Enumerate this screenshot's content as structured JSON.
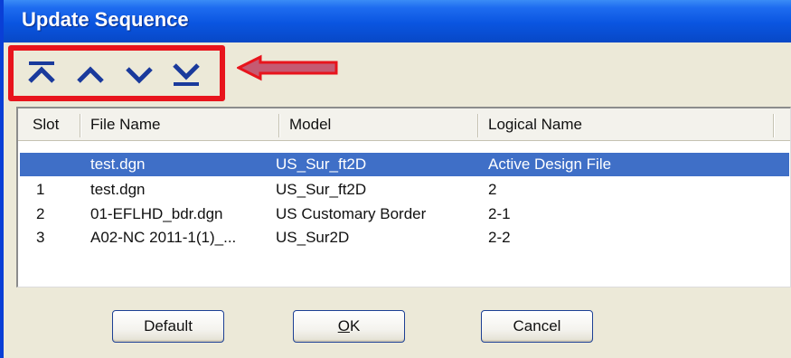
{
  "window": {
    "title": "Update Sequence"
  },
  "toolbar": {
    "buttons": [
      {
        "name": "move-to-top",
        "icon": "double-chevron-up-icon"
      },
      {
        "name": "move-up",
        "icon": "chevron-up-icon"
      },
      {
        "name": "move-down",
        "icon": "chevron-down-icon"
      },
      {
        "name": "move-to-bottom",
        "icon": "double-chevron-down-icon"
      }
    ]
  },
  "list": {
    "columns": [
      "Slot",
      "File Name",
      "Model",
      "Logical Name"
    ],
    "rows": [
      {
        "slot": "",
        "file": "test.dgn",
        "model": "US_Sur_ft2D",
        "logical": "Active Design File",
        "selected": true
      },
      {
        "slot": "1",
        "file": "test.dgn",
        "model": "US_Sur_ft2D",
        "logical": "2",
        "selected": false
      },
      {
        "slot": "2",
        "file": "01-EFLHD_bdr.dgn",
        "model": "US Customary Border",
        "logical": "2-1",
        "selected": false
      },
      {
        "slot": "3",
        "file": "A02-NC 2011-1(1)_...",
        "model": "US_Sur2D",
        "logical": "2-2",
        "selected": false
      }
    ]
  },
  "buttons": {
    "default": "Default",
    "ok_prefix": "O",
    "ok_rest": "K",
    "cancel": "Cancel"
  },
  "colors": {
    "title_bar": "#0a55e0",
    "selection": "#3f6fc7",
    "highlight": "#e8141c",
    "icon": "#1a3a9c"
  }
}
